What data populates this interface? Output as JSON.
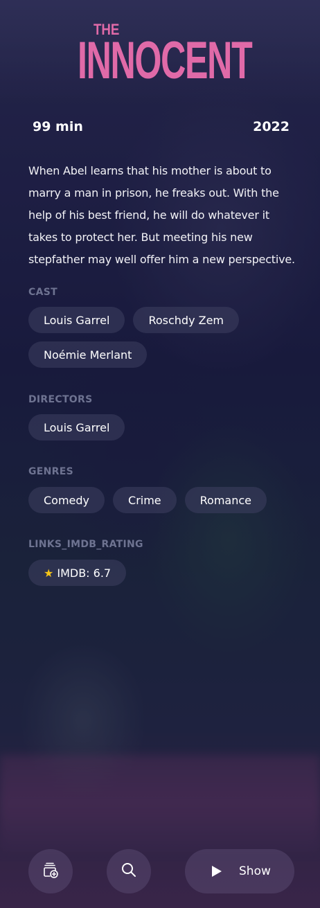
{
  "logo": {
    "small": "THE",
    "big": "INNOCENT"
  },
  "meta": {
    "duration": "99 min",
    "year": "2022"
  },
  "description": "When Abel learns that his mother is about to marry a man in prison, he freaks out. With the help of his best friend, he will do whatever it takes to protect her. But meeting his new stepfather may well offer him a new perspective.",
  "sections": {
    "cast": {
      "title": "CAST",
      "items": [
        "Louis Garrel",
        "Roschdy Zem",
        "Noémie Merlant"
      ]
    },
    "directors": {
      "title": "DIRECTORS",
      "items": [
        "Louis Garrel"
      ]
    },
    "genres": {
      "title": "GENRES",
      "items": [
        "Comedy",
        "Crime",
        "Romance"
      ]
    },
    "rating": {
      "title": "LINKS_IMDB_RATING",
      "label": "IMDB: 6.7",
      "icon": "star-icon"
    }
  },
  "actions": {
    "watchlist_icon": "add-to-library-icon",
    "search_icon": "search-icon",
    "show_label": "Show",
    "show_icon": "play-icon"
  },
  "colors": {
    "logo": "#e06aa8",
    "section_title": "#6e7391",
    "star": "#f5c518"
  }
}
